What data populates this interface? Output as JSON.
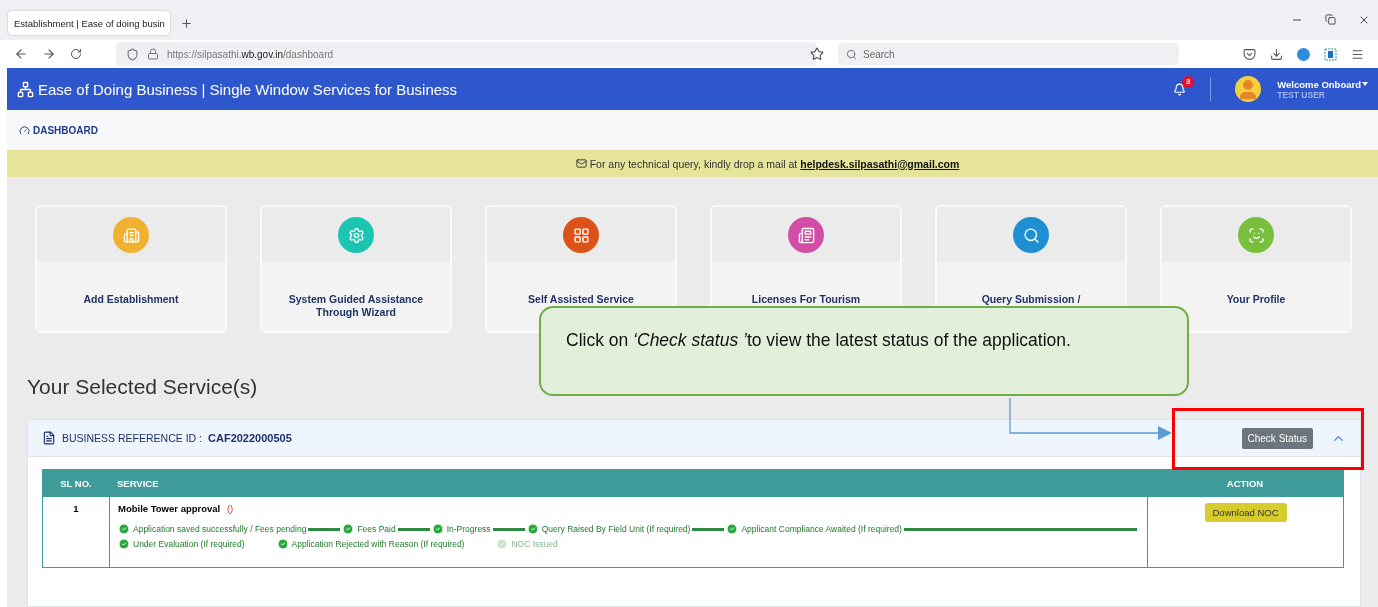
{
  "browser": {
    "tab_title": "Establishment | Ease of doing busin",
    "url_prefix": "https://silpasathi.",
    "url_domain": "wb.gov.in",
    "url_path": "/dashboard",
    "search": {
      "placeholder": "Search"
    }
  },
  "header": {
    "title": "Ease of Doing Business | Single Window Services for Business",
    "notifications": "3",
    "welcome": "Welcome Onboard",
    "user": "TEST USER"
  },
  "nav": [
    {
      "label": "DASHBOARD"
    }
  ],
  "notice": {
    "text": "For any technical query, kindly drop a mail at ",
    "email": "helpdesk.silpasathi@gmail.com"
  },
  "cards": [
    {
      "label": "Add Establishment",
      "color": "#f0b030",
      "kind": "building"
    },
    {
      "label": "System Guided Assistance Through Wizard",
      "color": "#1cc4b2",
      "kind": "gear"
    },
    {
      "label": "Self Assisted Service",
      "color": "#dc5218",
      "kind": "grid"
    },
    {
      "label": "Licenses For Tourism",
      "color": "#d24ea6",
      "kind": "license"
    },
    {
      "label": "Query Submission /",
      "color": "#1e90d2",
      "kind": "search"
    },
    {
      "label": "Your Profile",
      "color": "#79bf3e",
      "kind": "profile"
    }
  ],
  "section_title": "Your Selected Service(s)",
  "reference": {
    "label": "BUSINESS REFERENCE ID :",
    "id": "CAF2022000505",
    "button": "Check Status",
    "expanded": true
  },
  "table": {
    "columns": [
      "SL NO.",
      "SERVICE",
      "ACTION"
    ],
    "rows": [
      {
        "sl": "1",
        "service": "Mobile Tower approval",
        "note": "()",
        "action": "Download NOC",
        "progress_rows": [
          {
            "kind": "linked",
            "steps": [
              {
                "label": "Application saved successfully / Fees pending",
                "done": true
              },
              {
                "label": "Fees Paid",
                "done": true
              },
              {
                "label": "In-Progress",
                "done": true
              },
              {
                "label": "Query Raised By Field Unit (If required)",
                "done": true
              },
              {
                "label": "Applicant Compliance Awaited (If required)",
                "done": true
              }
            ]
          },
          {
            "kind": "spaced",
            "steps": [
              {
                "label": "Under Evaluation (If required)",
                "done": true
              },
              {
                "label": "Application Rejected with Reason (If required)",
                "done": true
              },
              {
                "label": "NOC Issued",
                "done": false
              }
            ]
          }
        ]
      }
    ]
  },
  "callout": {
    "before": "Click on ",
    "emphasis": "‘Check status ’",
    "after": "to view the latest status of the application."
  }
}
